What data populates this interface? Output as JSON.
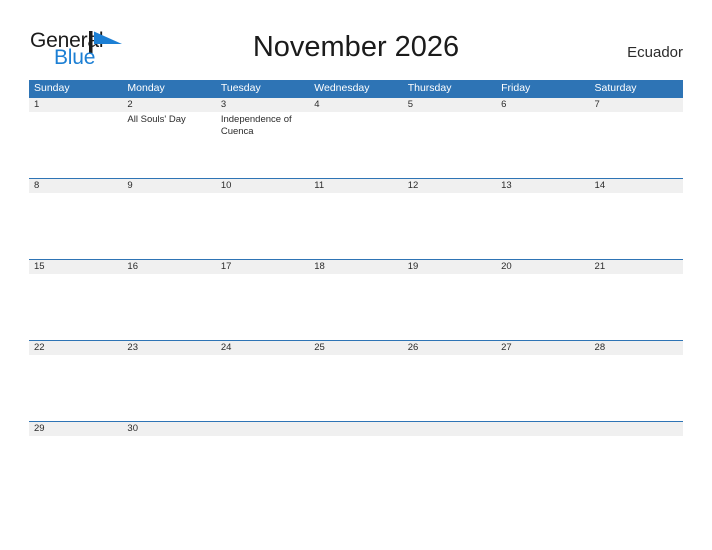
{
  "brand": {
    "word_one": "General",
    "word_two": "Blue",
    "flag_icon": "flag-triangle-icon",
    "accent_color": "#1c7fd4",
    "text_color": "#1b1b1b"
  },
  "header": {
    "title": "November 2026",
    "locale": "Ecuador",
    "header_bg_color": "#2e74b5",
    "daynum_bg_color": "#f0f0f0"
  },
  "calendar": {
    "weekdays": [
      "Sunday",
      "Monday",
      "Tuesday",
      "Wednesday",
      "Thursday",
      "Friday",
      "Saturday"
    ],
    "weeks": [
      {
        "days": [
          {
            "num": "1",
            "event": ""
          },
          {
            "num": "2",
            "event": "All Souls' Day"
          },
          {
            "num": "3",
            "event": "Independence of Cuenca"
          },
          {
            "num": "4",
            "event": ""
          },
          {
            "num": "5",
            "event": ""
          },
          {
            "num": "6",
            "event": ""
          },
          {
            "num": "7",
            "event": ""
          }
        ]
      },
      {
        "days": [
          {
            "num": "8",
            "event": ""
          },
          {
            "num": "9",
            "event": ""
          },
          {
            "num": "10",
            "event": ""
          },
          {
            "num": "11",
            "event": ""
          },
          {
            "num": "12",
            "event": ""
          },
          {
            "num": "13",
            "event": ""
          },
          {
            "num": "14",
            "event": ""
          }
        ]
      },
      {
        "days": [
          {
            "num": "15",
            "event": ""
          },
          {
            "num": "16",
            "event": ""
          },
          {
            "num": "17",
            "event": ""
          },
          {
            "num": "18",
            "event": ""
          },
          {
            "num": "19",
            "event": ""
          },
          {
            "num": "20",
            "event": ""
          },
          {
            "num": "21",
            "event": ""
          }
        ]
      },
      {
        "days": [
          {
            "num": "22",
            "event": ""
          },
          {
            "num": "23",
            "event": ""
          },
          {
            "num": "24",
            "event": ""
          },
          {
            "num": "25",
            "event": ""
          },
          {
            "num": "26",
            "event": ""
          },
          {
            "num": "27",
            "event": ""
          },
          {
            "num": "28",
            "event": ""
          }
        ]
      },
      {
        "days": [
          {
            "num": "29",
            "event": ""
          },
          {
            "num": "30",
            "event": ""
          },
          {
            "num": "",
            "event": ""
          },
          {
            "num": "",
            "event": ""
          },
          {
            "num": "",
            "event": ""
          },
          {
            "num": "",
            "event": ""
          },
          {
            "num": "",
            "event": ""
          }
        ]
      }
    ]
  }
}
